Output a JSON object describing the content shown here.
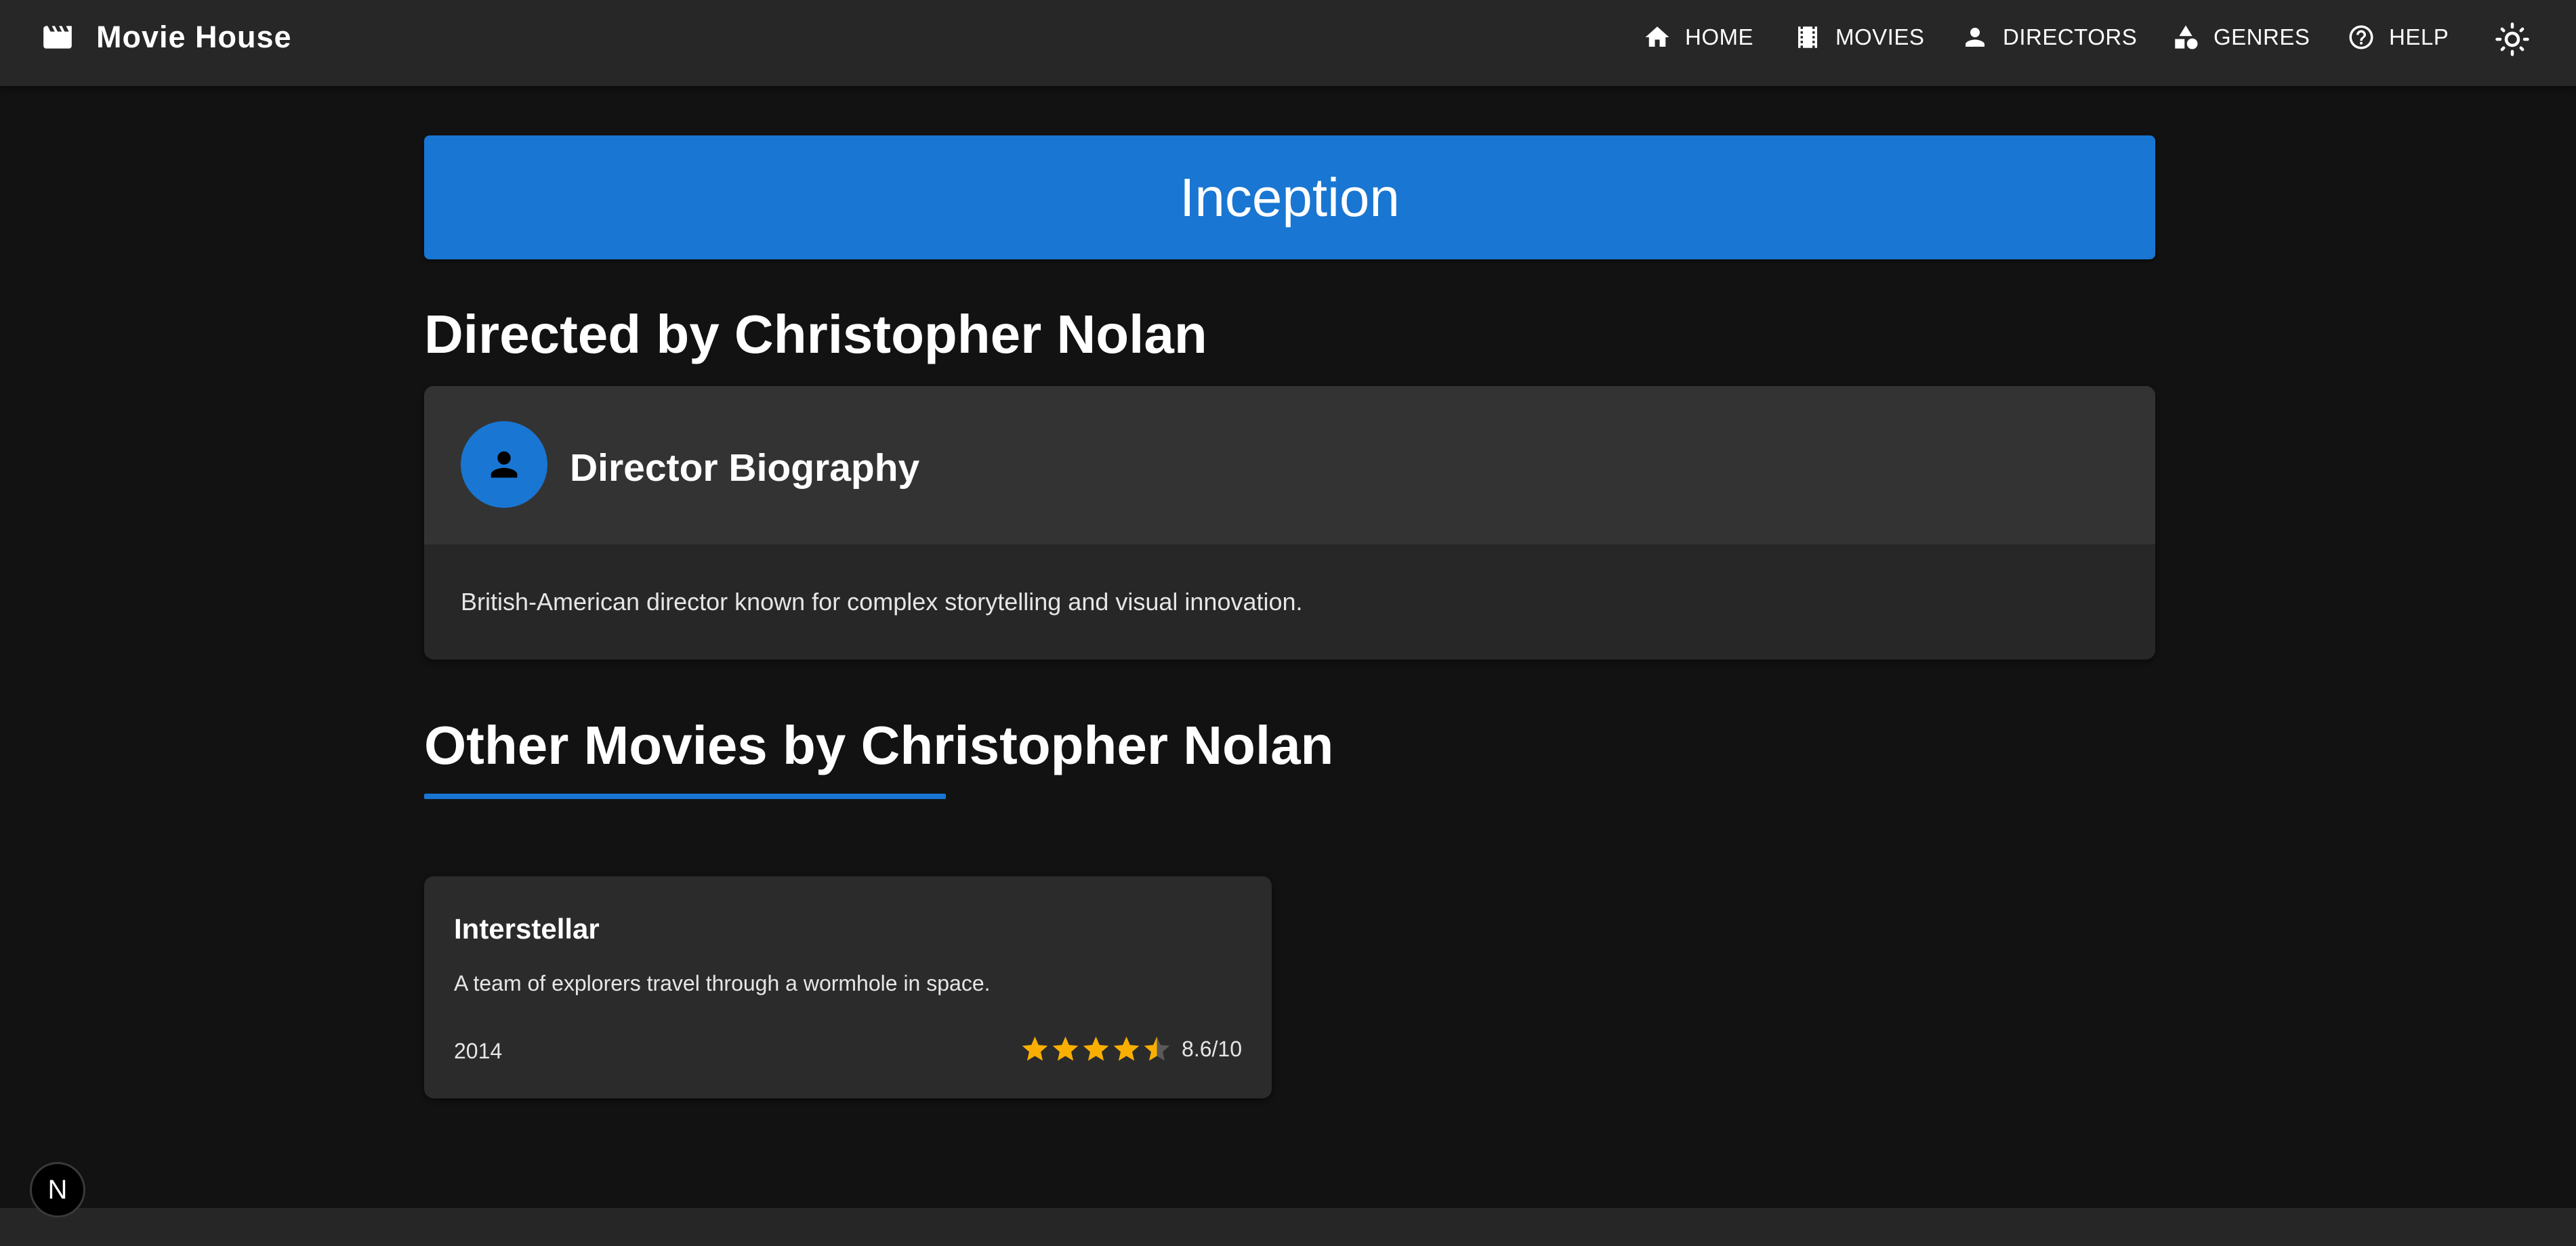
{
  "app": {
    "title": "Movie House",
    "brand_icon": "movie-clapperboard-icon"
  },
  "nav": {
    "items": [
      {
        "label": "HOME",
        "icon": "home-icon"
      },
      {
        "label": "MOVIES",
        "icon": "film-strip-icon"
      },
      {
        "label": "DIRECTORS",
        "icon": "person-icon"
      },
      {
        "label": "GENRES",
        "icon": "category-shapes-icon"
      },
      {
        "label": "HELP",
        "icon": "help-circle-icon"
      }
    ],
    "theme_toggle_icon": "sun-icon"
  },
  "movie": {
    "title": "Inception"
  },
  "director": {
    "heading": "Directed by Christopher Nolan",
    "bio_title": "Director Biography",
    "bio_text": "British-American director known for complex storytelling and visual innovation.",
    "avatar_icon": "person-icon"
  },
  "other_movies": {
    "heading": "Other Movies by Christopher Nolan",
    "items": [
      {
        "title": "Interstellar",
        "description": "A team of explorers travel through a wormhole in space.",
        "year": "2014",
        "stars": 4.5,
        "rating_text": "8.6/10"
      }
    ]
  },
  "dev_badge": {
    "label": "N"
  },
  "colors": {
    "background": "#121212",
    "appbar": "#272727",
    "accent": "#1976d2",
    "card": "#2b2b2b",
    "card_header": "#333333",
    "star": "#faaf00",
    "star_empty": "#5a5a5a"
  }
}
